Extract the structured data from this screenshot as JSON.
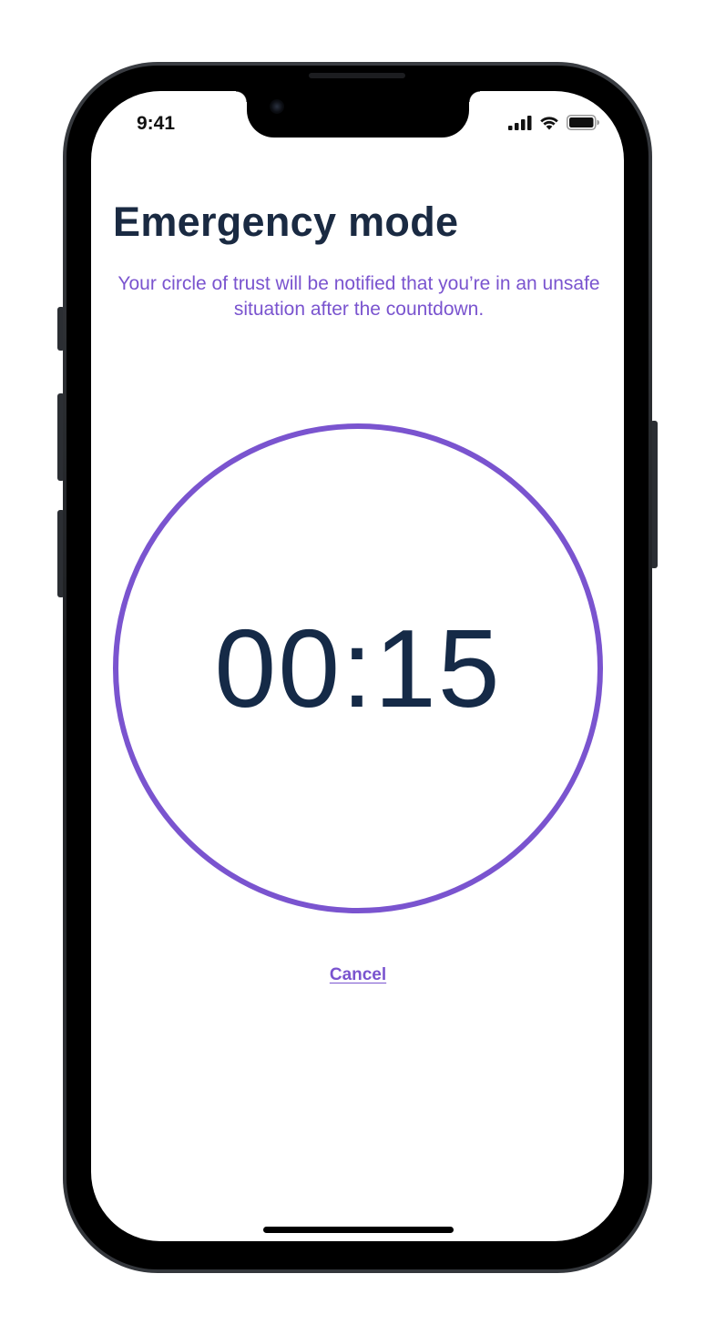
{
  "status_bar": {
    "time": "9:41",
    "icons": [
      "cellular-signal-icon",
      "wifi-icon",
      "battery-icon"
    ]
  },
  "screen": {
    "title": "Emergency mode",
    "subtitle": "Your circle of trust will be notified that you’re in an unsafe situation after the countdown.",
    "countdown": "00:15",
    "cancel_label": "Cancel"
  },
  "colors": {
    "accent": "#7a54cf",
    "title": "#1a2a42",
    "timer_text": "#152a47",
    "background": "#ffffff"
  }
}
